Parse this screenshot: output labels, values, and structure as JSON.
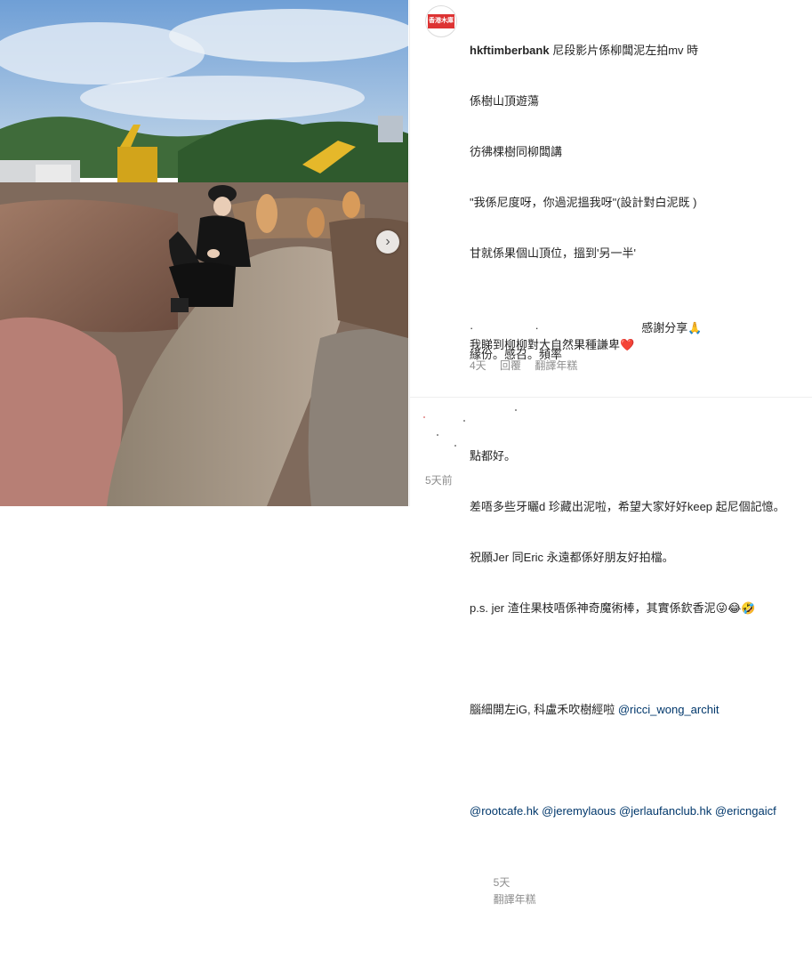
{
  "post": {
    "username": "hkftimberbank",
    "avatar_text": "香港木庫",
    "caption_lines": [
      "尼段影片係柳闆泥左拍mv 時",
      "係樹山頂遊蕩",
      "彷彿棵樹同柳闆講",
      "\"我係尼度呀，你過泥搵我呀\"(設計對白泥既 )",
      "甘就係果個山頂位，搵到'另一半'",
      "",
      "緣份。感召。頻率",
      "",
      "點都好。",
      "差唔多些牙曬d 珍藏出泥啦，希望大家好好keep 起尼個記憶。",
      "祝願Jer 同Eric 永遠都係好朋友好拍檔。",
      "p.s. jer 渣住果枝唔係神奇魔術棒，其實係欽香泥😜😂🤣",
      "",
      "腦細開左iG, 科盧禾吹樹經啦 "
    ],
    "mention_inline": "@ricci_wong_archit",
    "mentions": "@rootcafe.hk @jeremylaous @jerlaufanclub.hk @ericngaicf",
    "post_meta": {
      "age": "5天",
      "translate": "翻譯年糕"
    }
  },
  "comments": [
    {
      "line1": "感謝分享🙏",
      "line2": "我睇到柳柳對大自然果種謙卑",
      "heart": "❤️",
      "meta": {
        "age": "4天",
        "reply": "回覆",
        "translate": "翻譯年糕"
      }
    }
  ],
  "footer": {
    "time_ago": "5天前"
  },
  "carousel": {
    "next_icon": "›"
  }
}
